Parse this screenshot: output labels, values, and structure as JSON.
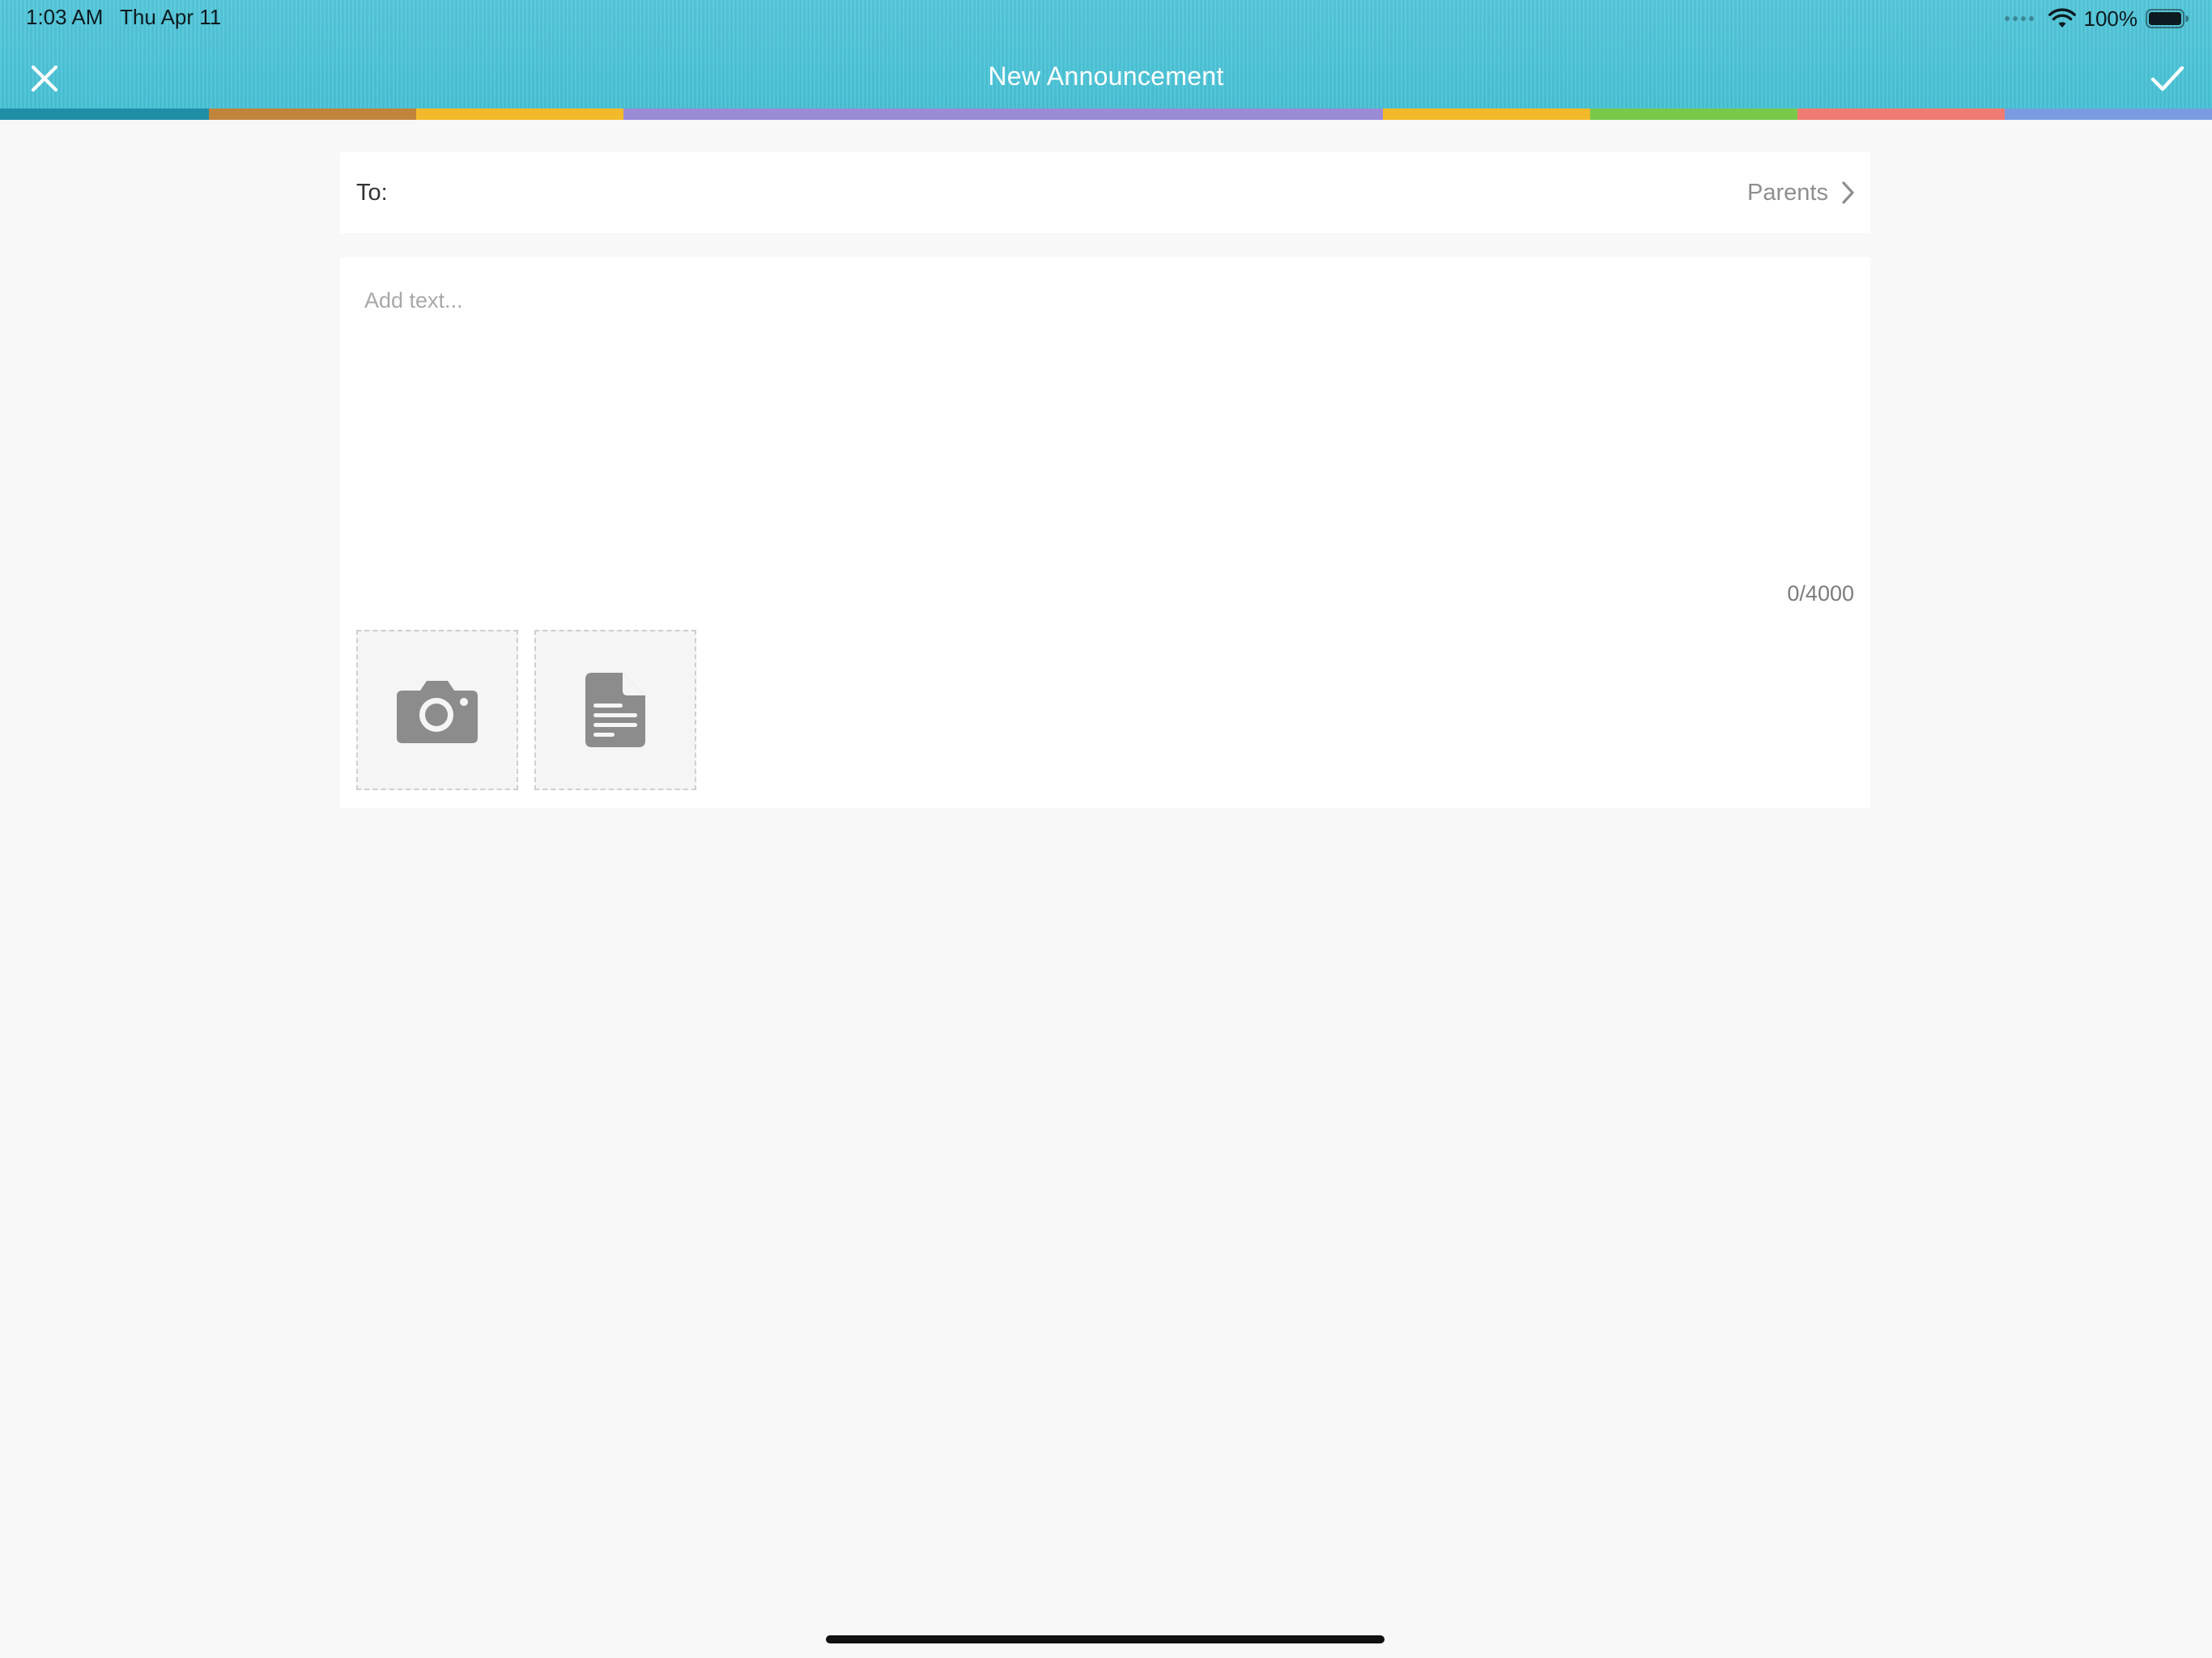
{
  "status_bar": {
    "time": "1:03 AM",
    "date": "Thu Apr 11",
    "battery_percent": "100%",
    "icons": [
      "signal-dots-icon",
      "wifi-icon",
      "battery-icon"
    ]
  },
  "header": {
    "title": "New Announcement",
    "close_icon": "close-icon",
    "confirm_icon": "checkmark-icon",
    "background_color": "#4dc6d9",
    "rainbow_colors": [
      "#1f8fa8",
      "#c0843a",
      "#f2b92a",
      "#9b8ad6",
      "#9b8ad6",
      "#9b8ad6",
      "#9b8ad6",
      "#f2b92a",
      "#78c94a",
      "#f07b72",
      "#7a9be0"
    ]
  },
  "recipient": {
    "label": "To:",
    "value": "Parents",
    "chevron_icon": "chevron-right-icon"
  },
  "compose": {
    "placeholder": "Add text...",
    "char_count": "0/4000",
    "attachments": [
      {
        "icon": "camera-icon"
      },
      {
        "icon": "document-icon"
      }
    ]
  }
}
